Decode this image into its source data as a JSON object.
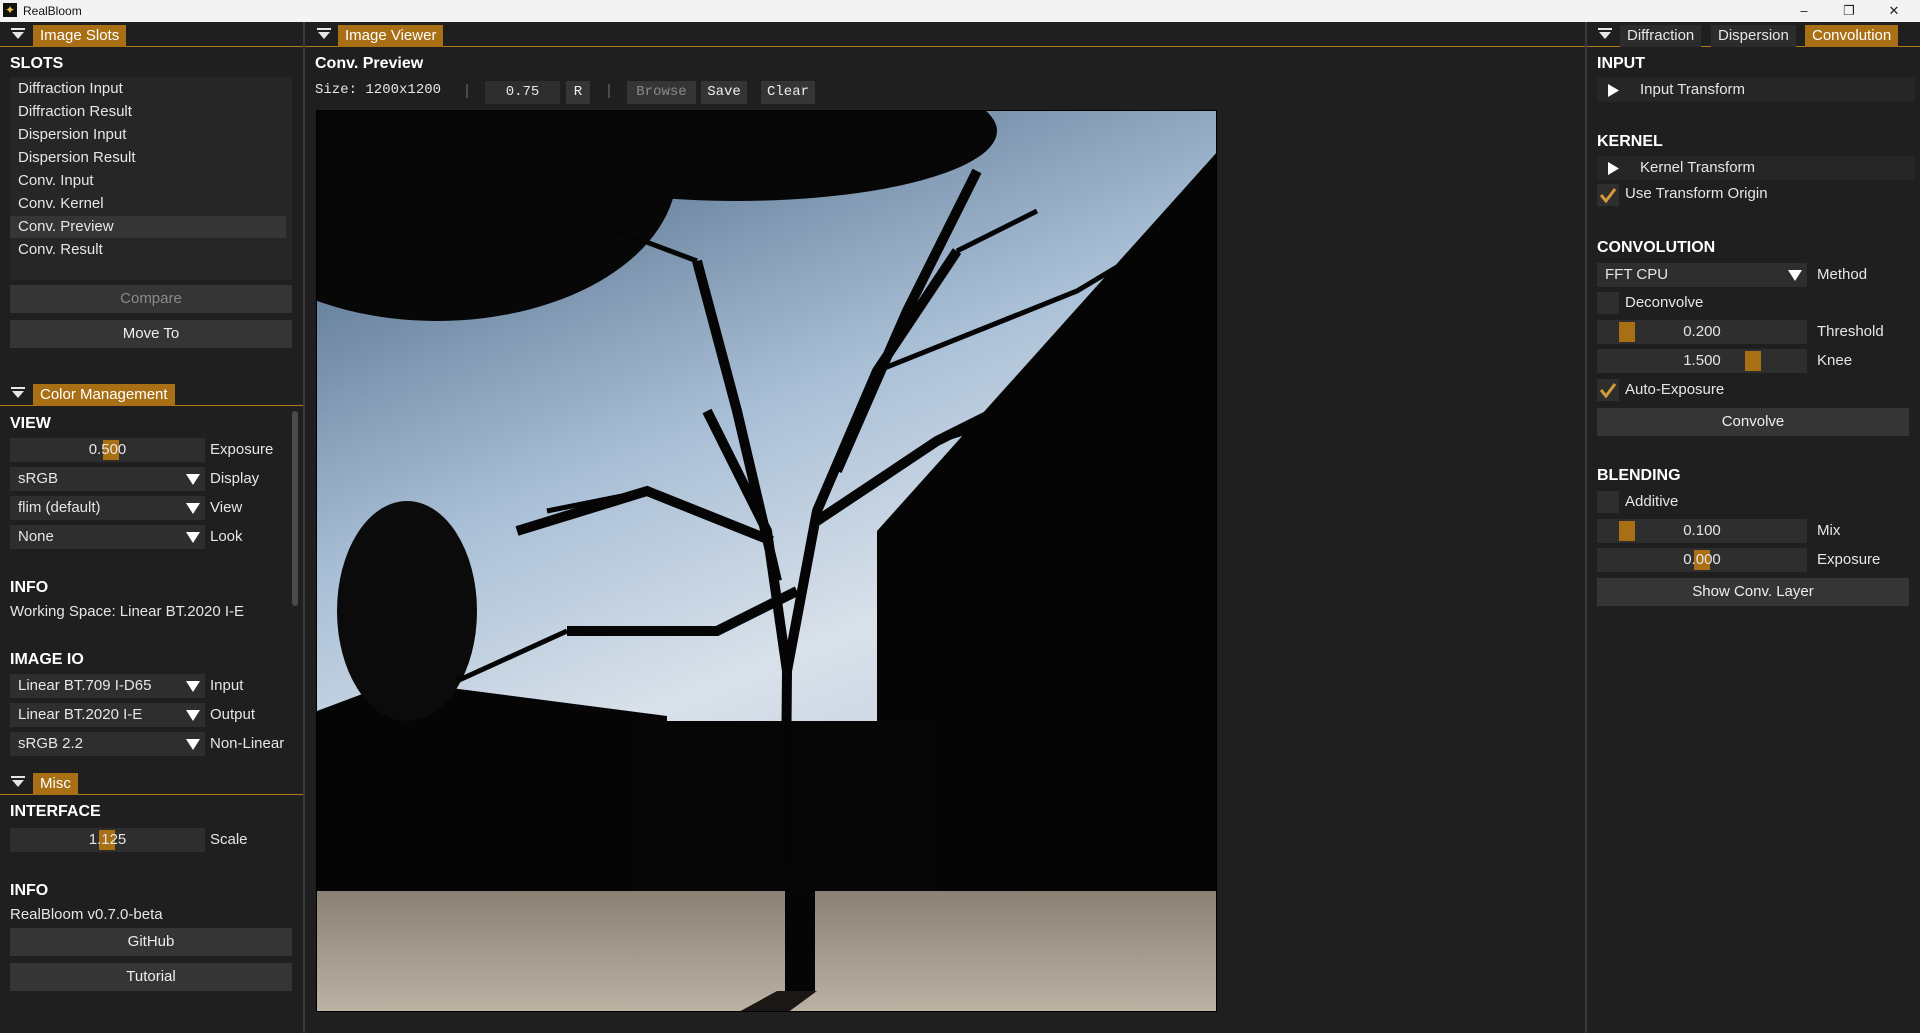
{
  "window": {
    "title": "RealBloom",
    "minimize": "–",
    "maximize": "❐",
    "close": "✕"
  },
  "slots_panel": {
    "tab": "Image Slots",
    "heading": "SLOTS",
    "items": [
      "Diffraction Input",
      "Diffraction Result",
      "Dispersion Input",
      "Dispersion Result",
      "Conv. Input",
      "Conv. Kernel",
      "Conv. Preview",
      "Conv. Result"
    ],
    "selected": "Conv. Preview",
    "compare": "Compare",
    "move_to": "Move To"
  },
  "color_panel": {
    "tab": "Color Management",
    "view_heading": "VIEW",
    "exposure": {
      "value": "0.500",
      "label": "Exposure"
    },
    "display": {
      "value": "sRGB",
      "label": "Display"
    },
    "view": {
      "value": "flim (default)",
      "label": "View"
    },
    "look": {
      "value": "None",
      "label": "Look"
    },
    "info_heading": "INFO",
    "working_space": "Working Space: Linear BT.2020 I-E",
    "io_heading": "IMAGE IO",
    "input": {
      "value": "Linear BT.709 I-D65",
      "label": "Input"
    },
    "output": {
      "value": "Linear BT.2020 I-E",
      "label": "Output"
    },
    "nonlinear": {
      "value": "sRGB 2.2",
      "label": "Non-Linear"
    }
  },
  "misc_panel": {
    "tab": "Misc",
    "interface_heading": "INTERFACE",
    "scale": {
      "value": "1.125",
      "label": "Scale"
    },
    "info_heading": "INFO",
    "version": "RealBloom v0.7.0-beta",
    "github": "GitHub",
    "tutorial": "Tutorial"
  },
  "viewer": {
    "tab": "Image Viewer",
    "title": "Conv. Preview",
    "size": "Size: 1200x1200",
    "sep1": "|",
    "zoom": "0.75",
    "reset": "R",
    "sep2": "|",
    "browse": "Browse",
    "save": "Save",
    "clear": "Clear"
  },
  "right_panel": {
    "tabs": [
      "Diffraction",
      "Dispersion",
      "Convolution"
    ],
    "active_tab": "Convolution",
    "input_heading": "INPUT",
    "input_transform": "Input Transform",
    "kernel_heading": "KERNEL",
    "kernel_transform": "Kernel Transform",
    "use_transform_origin": {
      "label": "Use Transform Origin",
      "checked": true
    },
    "convolution_heading": "CONVOLUTION",
    "method": {
      "value": "FFT CPU",
      "label": "Method"
    },
    "deconvolve": {
      "label": "Deconvolve",
      "checked": false
    },
    "threshold": {
      "value": "0.200",
      "label": "Threshold"
    },
    "knee": {
      "value": "1.500",
      "label": "Knee"
    },
    "auto_exposure": {
      "label": "Auto-Exposure",
      "checked": true
    },
    "convolve": "Convolve",
    "blending_heading": "BLENDING",
    "additive": {
      "label": "Additive",
      "checked": false
    },
    "mix": {
      "value": "0.100",
      "label": "Mix"
    },
    "exposure": {
      "value": "0.000",
      "label": "Exposure"
    },
    "show_layer": "Show Conv. Layer"
  },
  "colors": {
    "accent": "#a86f14",
    "bg": "#1f1f1f",
    "field": "#2e2e2e",
    "button": "#353535"
  }
}
